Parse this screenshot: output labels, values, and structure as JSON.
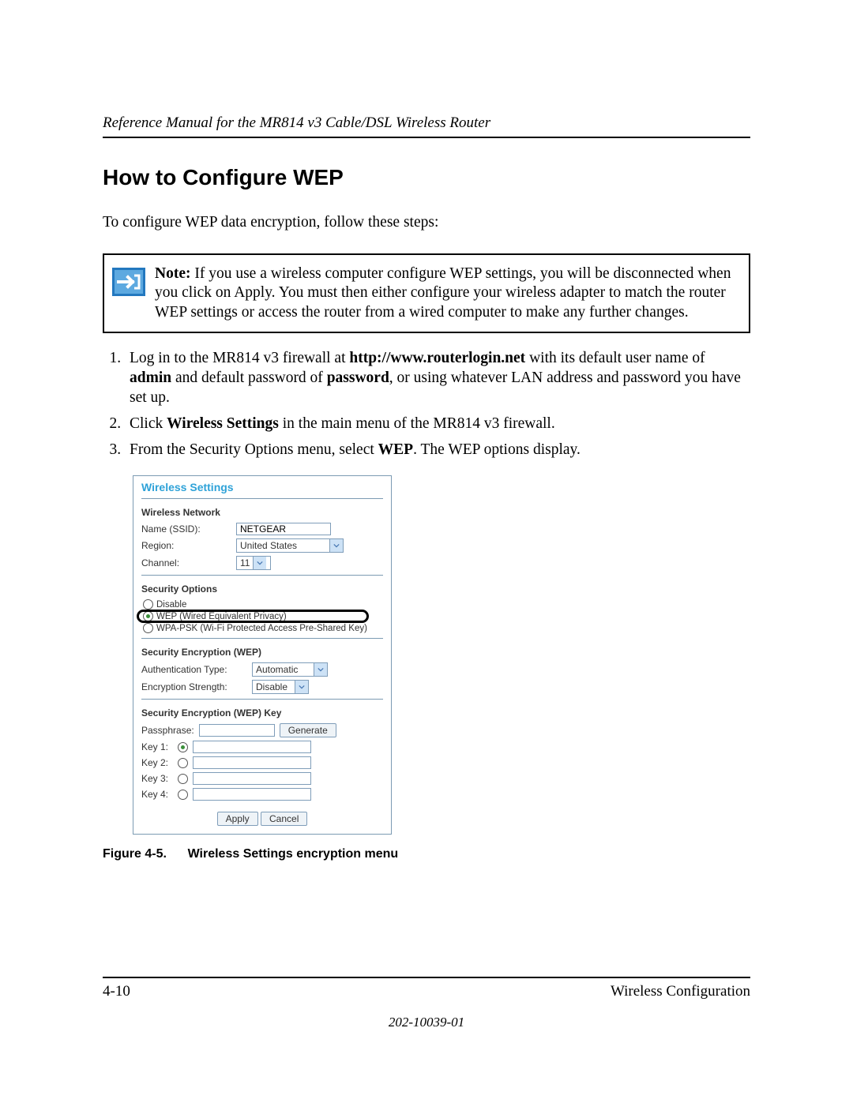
{
  "header": {
    "title": "Reference Manual for the MR814 v3 Cable/DSL Wireless Router"
  },
  "heading": "How to Configure WEP",
  "intro": "To configure WEP data encryption, follow these steps:",
  "note": {
    "label": "Note:",
    "text": "If you use a wireless computer configure WEP settings, you will be disconnected when you click on Apply. You must then either configure your wireless adapter to match the router WEP settings or access the router from a wired computer to make any further changes."
  },
  "steps": {
    "one": {
      "pre": "Log in to the MR814 v3 firewall at ",
      "url": "http://www.routerlogin.net",
      "mid": " with its default user name of ",
      "user": "admin",
      "mid2": " and default password of ",
      "pass": "password",
      "post": ", or using whatever LAN address and password you have set up."
    },
    "two": {
      "pre": "Click ",
      "bold": "Wireless Settings",
      "post": " in the main menu of the MR814 v3 firewall."
    },
    "three": {
      "pre": "From the Security Options menu, select ",
      "bold": "WEP",
      "post": ". The WEP options display."
    }
  },
  "panel": {
    "title": "Wireless Settings",
    "network": {
      "heading": "Wireless Network",
      "ssid_label": "Name (SSID):",
      "ssid": "NETGEAR",
      "region_label": "Region:",
      "region": "United States",
      "channel_label": "Channel:",
      "channel": "11"
    },
    "security": {
      "heading": "Security Options",
      "disable": "Disable",
      "wep": "WEP (Wired Equivalent Privacy)",
      "wpa": "WPA-PSK (Wi-Fi Protected Access Pre-Shared Key)"
    },
    "enc": {
      "heading": "Security Encryption (WEP)",
      "auth_label": "Authentication Type:",
      "auth": "Automatic",
      "strength_label": "Encryption Strength:",
      "strength": "Disable"
    },
    "keys": {
      "heading": "Security Encryption (WEP) Key",
      "pass_label": "Passphrase:",
      "generate": "Generate",
      "k1": "Key 1:",
      "k2": "Key 2:",
      "k3": "Key 3:",
      "k4": "Key 4:"
    },
    "apply": "Apply",
    "cancel": "Cancel"
  },
  "figure": {
    "label": "Figure 4-5.",
    "caption": "Wireless Settings encryption menu"
  },
  "footer": {
    "page": "4-10",
    "section": "Wireless Configuration",
    "docid": "202-10039-01"
  }
}
